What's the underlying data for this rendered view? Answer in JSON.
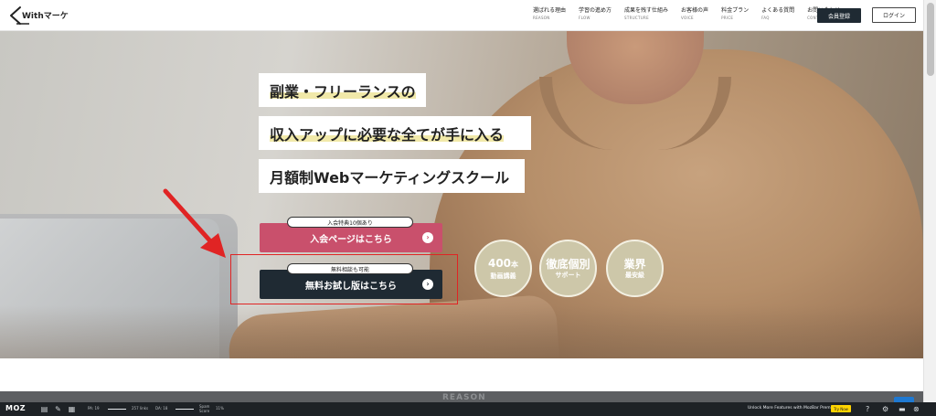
{
  "header": {
    "logo_text": "Withマーケ",
    "nav": [
      {
        "jp": "選ばれる理由",
        "en": "REASON"
      },
      {
        "jp": "学習の進め方",
        "en": "FLOW"
      },
      {
        "jp": "成果を残す仕組み",
        "en": "STRUCTURE"
      },
      {
        "jp": "お客様の声",
        "en": "VOICE"
      },
      {
        "jp": "料金プラン",
        "en": "PRICE"
      },
      {
        "jp": "よくある質問",
        "en": "FAQ"
      },
      {
        "jp": "お問い合わせ",
        "en": "CONTACT"
      }
    ],
    "member_button": "会員登録",
    "login_button": "ログイン"
  },
  "hero": {
    "headline_1": "副業・フリーランスの",
    "headline_2": "収入アップに必要な全てが手に入る",
    "headline_3": "月額制Webマーケティングスクール",
    "cta_primary": {
      "badge": "入会特典10個あり",
      "label": "入会ページはこちら"
    },
    "cta_secondary": {
      "badge": "無料相談も可能",
      "label": "無料お試し版はこちら"
    },
    "features": [
      {
        "big": "400",
        "unit": "本",
        "small": "動画講義"
      },
      {
        "big": "徹底個別",
        "small": "サポート"
      },
      {
        "big": "業界",
        "small": "最安級"
      }
    ]
  },
  "section_next": {
    "label": "REASON"
  },
  "mozbar": {
    "logo": "MOZ",
    "pa": "PA: 19",
    "links": "257 links",
    "da": "DA: 18",
    "spam": "Spam Score",
    "spam_value": "11%",
    "upsell": "Unlock More Features with MozBar Premium",
    "try_label": "Try Now",
    "help": "?",
    "colors": {
      "bar": "#1e2226",
      "try": "#ffd400"
    }
  },
  "colors": {
    "cta_pink": "#c9506c",
    "cta_dark": "#1f2a33",
    "annotation_red": "#e02424",
    "circle_fill": "#cdc7a9"
  }
}
